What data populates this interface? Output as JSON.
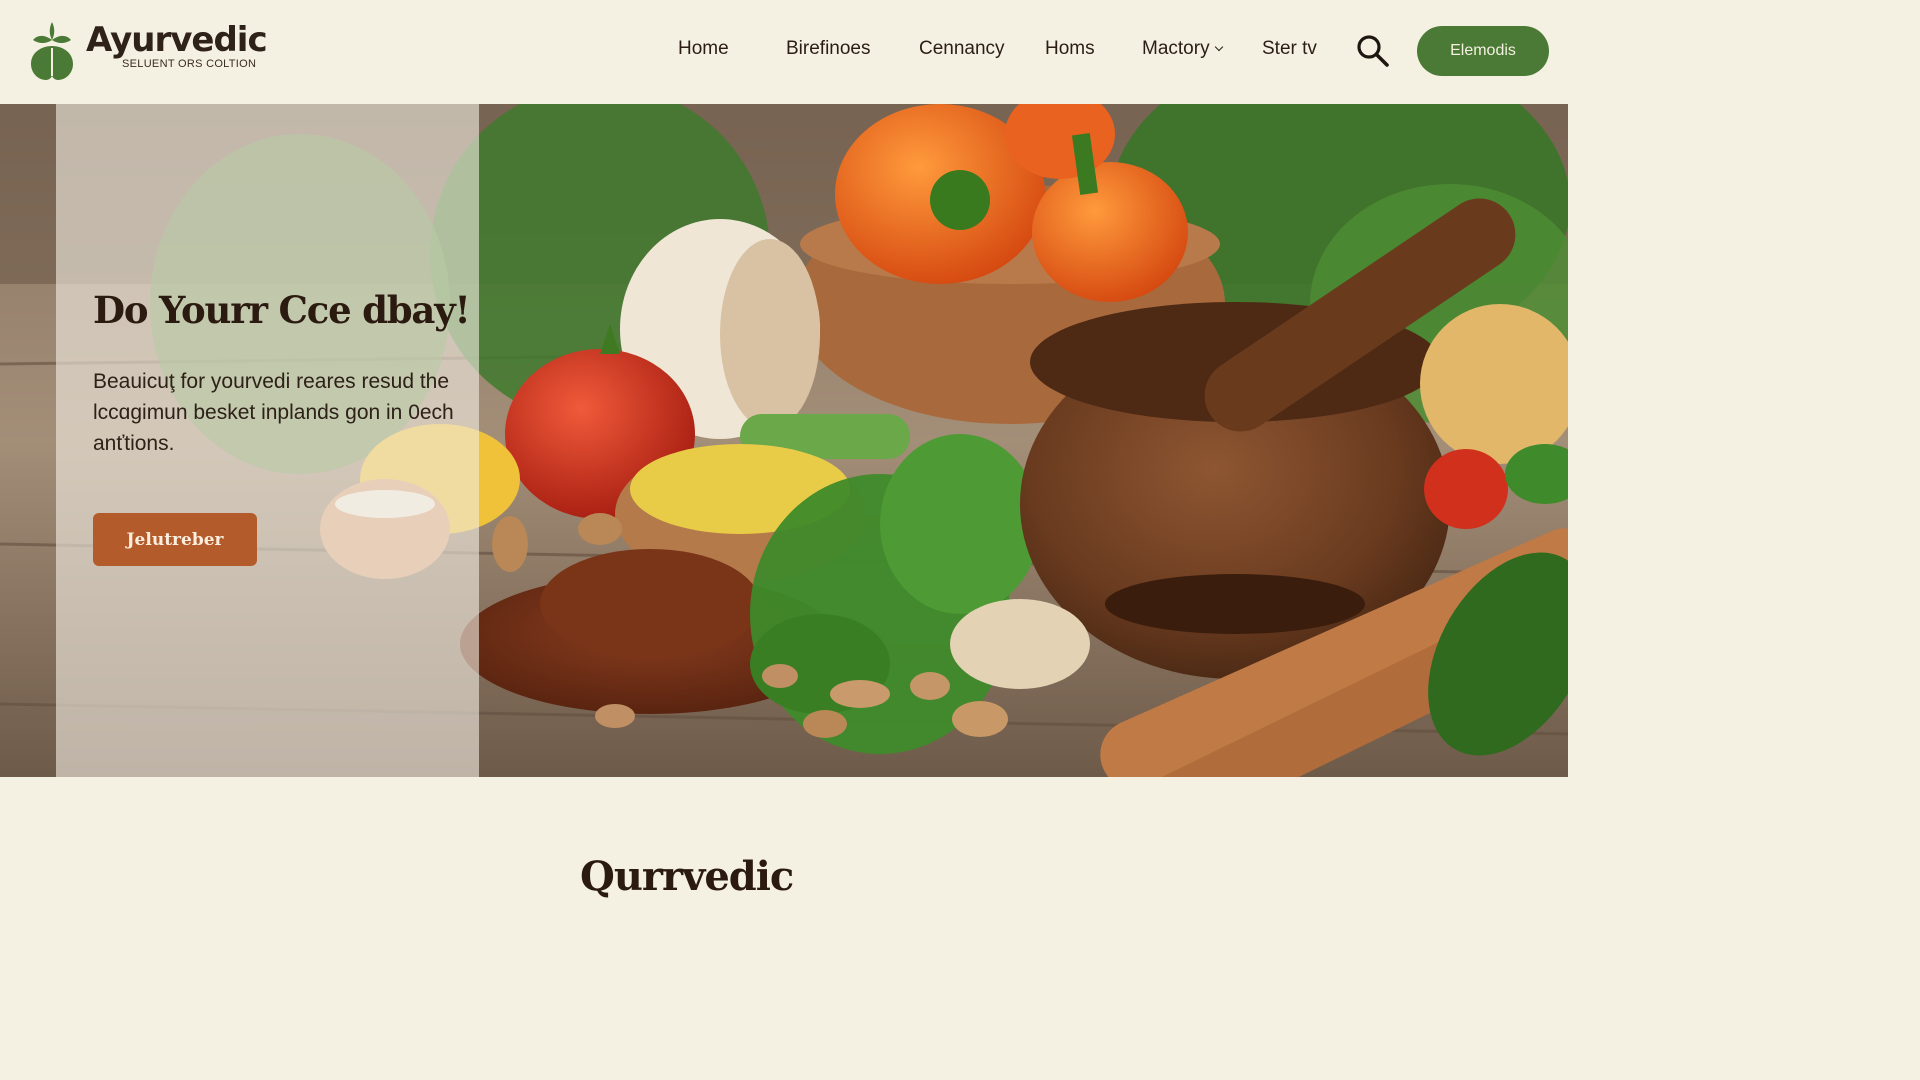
{
  "brand": {
    "name": "Ayurvedic",
    "tagline": "SELUENT ORS COLTION",
    "leaf_color": "#4a7a36"
  },
  "nav": {
    "items": [
      {
        "label": "Home"
      },
      {
        "label": "Birefinoes"
      },
      {
        "label": "Cennancy"
      },
      {
        "label": "Homs"
      },
      {
        "label": "Mactory",
        "has_dropdown": true
      },
      {
        "label": "Ster tv"
      }
    ],
    "search_icon": "search-icon",
    "cta_label": "Elemodis",
    "cta_color": "#4a7a36"
  },
  "hero": {
    "title": "Do Yourr Cce dbay!",
    "description": "Beauicuţ for yourvedi reares resud the lccɑgimun besket inplands ɡon in 0ech anťtions.",
    "button_label": "Jelutreber",
    "button_color": "#b35b2a"
  },
  "section": {
    "title": "Qurrvedic"
  }
}
